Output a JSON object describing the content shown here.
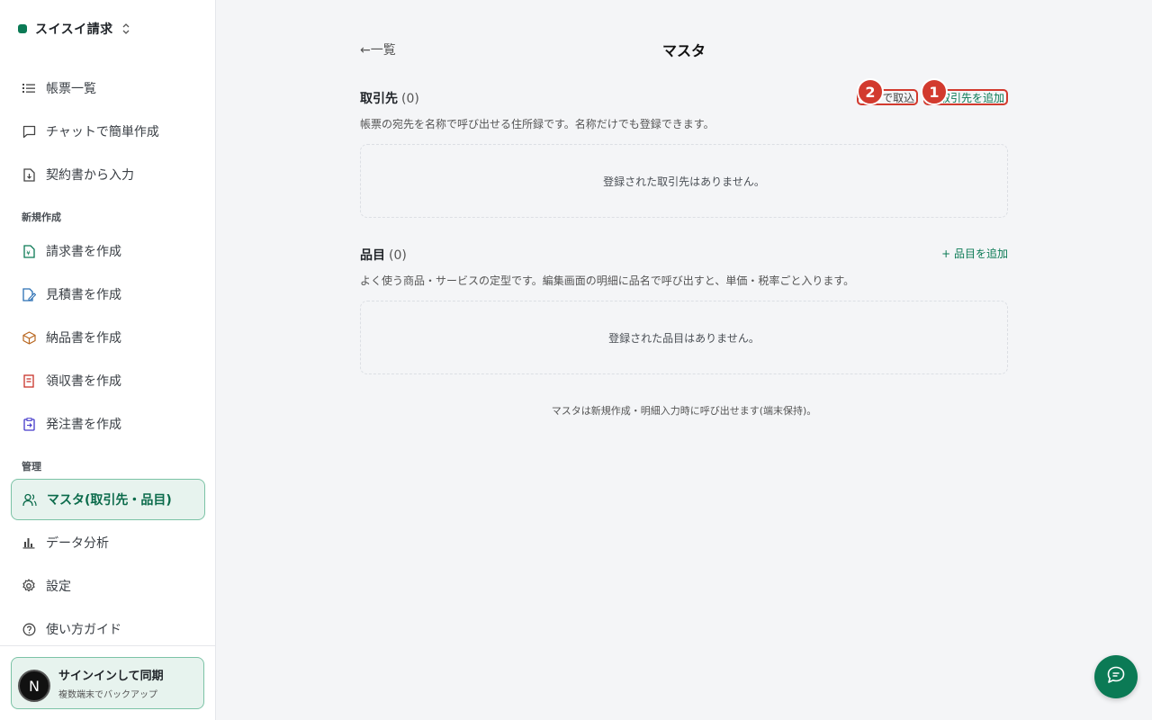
{
  "brand": {
    "name": "スイスイ請求"
  },
  "nav": {
    "top": [
      {
        "label": "帳票一覧",
        "icon": "list-icon"
      },
      {
        "label": "チャットで簡単作成",
        "icon": "chat-icon"
      },
      {
        "label": "契約書から入力",
        "icon": "file-import-icon"
      }
    ],
    "create_label": "新規作成",
    "create": [
      {
        "label": "請求書を作成",
        "icon": "invoice-icon"
      },
      {
        "label": "見積書を作成",
        "icon": "quote-icon"
      },
      {
        "label": "納品書を作成",
        "icon": "box-icon"
      },
      {
        "label": "領収書を作成",
        "icon": "receipt-icon"
      },
      {
        "label": "発注書を作成",
        "icon": "order-icon"
      }
    ],
    "manage_label": "管理",
    "manage": [
      {
        "label": "マスタ(取引先・品目)",
        "icon": "users-icon",
        "active": true
      },
      {
        "label": "データ分析",
        "icon": "bar-chart-icon"
      },
      {
        "label": "設定",
        "icon": "gear-icon"
      },
      {
        "label": "使い方ガイド",
        "icon": "help-icon"
      }
    ]
  },
  "signin": {
    "title": "サインインして同期",
    "subtitle": "複数端末でバックアップ",
    "avatar": "N"
  },
  "header": {
    "back": "←一覧",
    "title": "マスタ"
  },
  "clients": {
    "title": "取引先",
    "count": "(0)",
    "description": "帳票の宛先を名称で呼び出せる住所録です。名称だけでも登録できます。",
    "csv_label": "CSVで取込",
    "add_label": "+ 取引先を追加",
    "empty": "登録された取引先はありません。"
  },
  "items": {
    "title": "品目",
    "count": "(0)",
    "description": "よく使う商品・サービスの定型です。編集画面の明細に品名で呼び出すと、単価・税率ごと入ります。",
    "add_label": "+ 品目を追加",
    "empty": "登録された品目はありません。"
  },
  "badges": [
    "2",
    "1"
  ],
  "footnote": "マスタは新規作成・明細入力時に呼び出せます(端末保持)。",
  "colors": {
    "accent": "#0b7a55",
    "highlight": "#d23a2e"
  }
}
